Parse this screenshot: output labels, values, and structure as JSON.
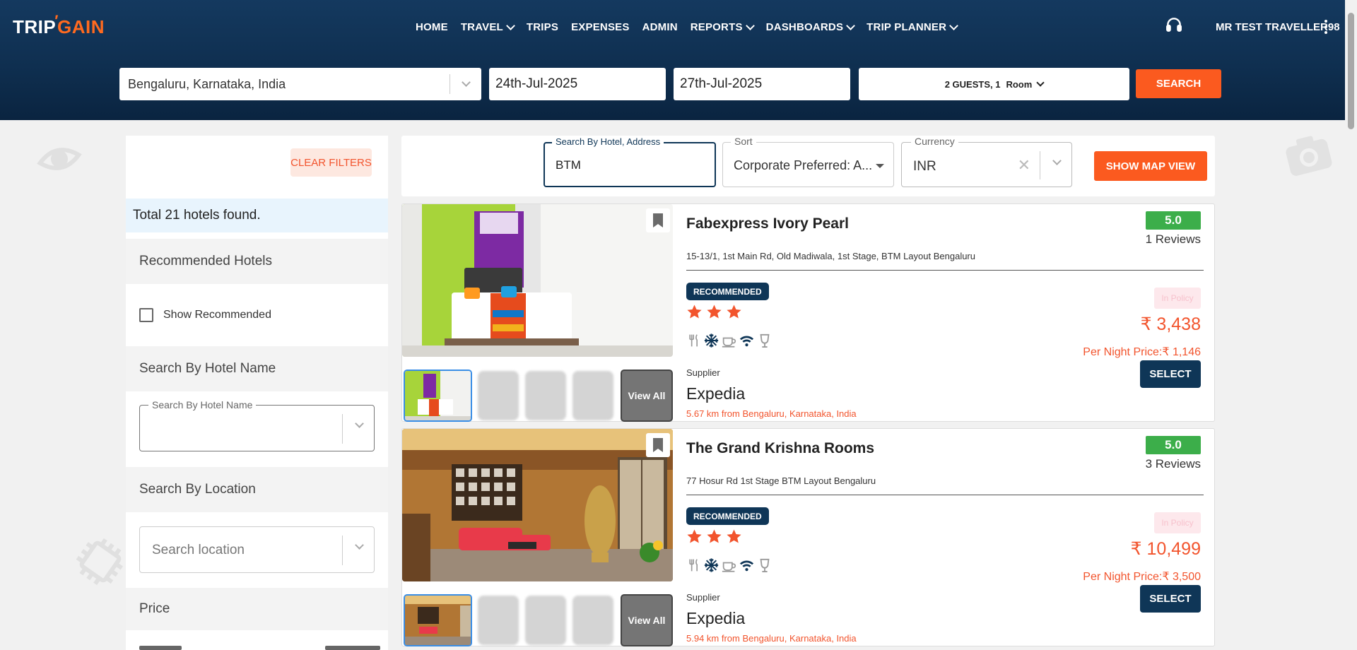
{
  "header": {
    "logo_text_trip": "TRIP",
    "logo_text_gain": "GAIN",
    "nav": [
      {
        "label": "HOME",
        "has_chevron": false
      },
      {
        "label": "TRAVEL",
        "has_chevron": true
      },
      {
        "label": "TRIPS",
        "has_chevron": false
      },
      {
        "label": "EXPENSES",
        "has_chevron": false
      },
      {
        "label": "ADMIN",
        "has_chevron": false
      },
      {
        "label": "REPORTS",
        "has_chevron": true
      },
      {
        "label": "DASHBOARDS",
        "has_chevron": true
      },
      {
        "label": "TRIP PLANNER",
        "has_chevron": true
      }
    ],
    "user_name": "MR TEST TRAVELLER98",
    "support_icon": "headset-icon"
  },
  "search": {
    "location": "Bengaluru, Karnataka, India",
    "checkin": "24th-Jul-2025",
    "checkout": "27th-Jul-2025",
    "guests": "2 GUESTS, 1",
    "room": "Room",
    "search_label": "SEARCH"
  },
  "sidebar": {
    "clear_filters": "CLEAR FILTERS",
    "total": "Total 21 hotels found.",
    "recommended_title": "Recommended Hotels",
    "show_recommended": "Show Recommended",
    "hotel_name_title": "Search By Hotel Name",
    "hotel_name_field_label": "Search By Hotel Name",
    "hotel_name_value": "",
    "location_title": "Search By Location",
    "location_placeholder": "Search location",
    "price_title": "Price"
  },
  "filters": {
    "search_label": "Search By Hotel, Address",
    "search_value": "BTM",
    "sort_label": "Sort",
    "sort_value": "Corporate Preferred: A...",
    "currency_label": "Currency",
    "currency_value": "INR",
    "map_button": "SHOW MAP VIEW"
  },
  "hotels": [
    {
      "name": "Fabexpress Ivory Pearl",
      "address": "15-13/1, 1st Main Rd, Old Madiwala, 1st Stage, BTM Layout Bengaluru",
      "rating": "5.0",
      "reviews": "1 Reviews",
      "badge": "RECOMMENDED",
      "stars": 3,
      "policy": "In Policy",
      "price": "₹ 3,438",
      "per_night": "Per Night Price:₹ 1,146",
      "supplier_label": "Supplier",
      "supplier": "Expedia",
      "distance": "5.67 km from Bengaluru, Karnataka, India",
      "select": "SELECT",
      "view_all": "View All"
    },
    {
      "name": "The Grand Krishna Rooms",
      "address": "77 Hosur Rd 1st Stage BTM Layout Bengaluru",
      "rating": "5.0",
      "reviews": "3 Reviews",
      "badge": "RECOMMENDED",
      "stars": 3,
      "policy": "In Policy",
      "price": "₹ 10,499",
      "per_night": "Per Night Price:₹ 3,500",
      "supplier_label": "Supplier",
      "supplier": "Expedia",
      "distance": "5.94 km from Bengaluru, Karnataka, India",
      "select": "SELECT",
      "view_all": "View All"
    }
  ],
  "amenity_icons": [
    "restaurant-icon",
    "ac-snowflake-icon",
    "coffee-icon",
    "wifi-icon",
    "bar-glass-icon"
  ],
  "colors": {
    "header_bg": "#0f2f50",
    "accent_orange": "#fb5a1f",
    "navy": "#0f3657",
    "rating_green": "#3cae4a",
    "star_orange": "#f2542d"
  }
}
